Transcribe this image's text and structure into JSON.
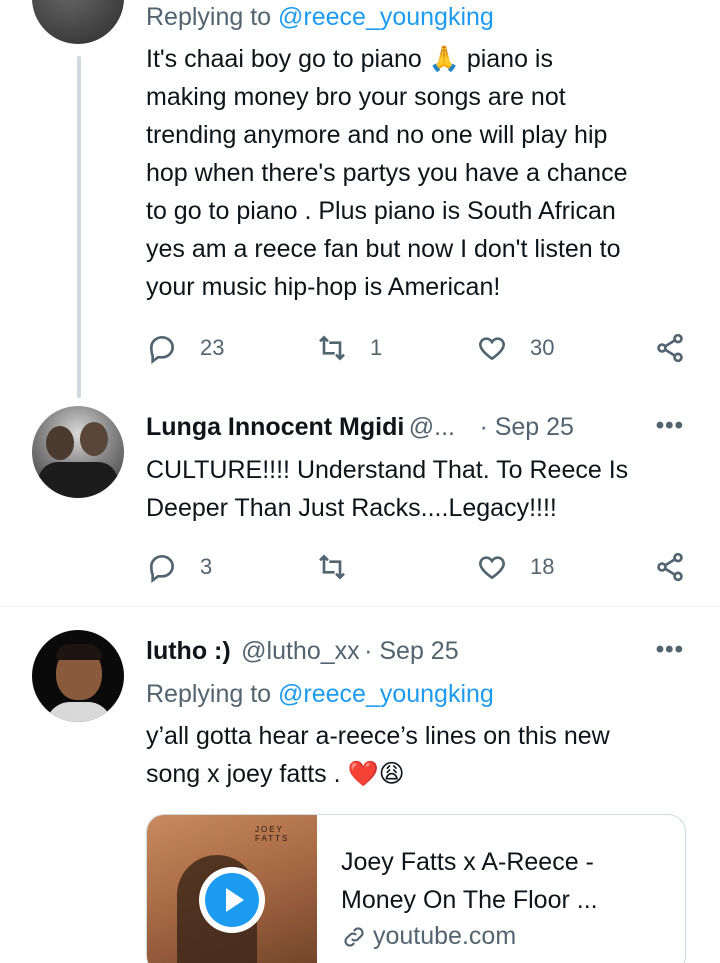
{
  "tweet1": {
    "replying_prefix": "Replying to",
    "replying_handle": "@reece_youngking",
    "lines": [
      "It's chaai boy go to piano 🙏 piano is",
      "making money bro your songs are not",
      "trending anymore and no one will play hip",
      "hop when there's partys you have a chance",
      "to go to piano . Plus piano is South African",
      "yes am a reece fan but now I don't listen to",
      "your music hip-hop is American!"
    ],
    "replies": "23",
    "retweets": "1",
    "likes": "30"
  },
  "tweet2": {
    "name": "Lunga Innocent Mgidi",
    "handle": "@...",
    "date": "· Sep 25",
    "lines": [
      "CULTURE!!!! Understand That. To Reece Is",
      "Deeper Than Just Racks....Legacy!!!!"
    ],
    "replies": "3",
    "retweets": "",
    "likes": "18"
  },
  "tweet3": {
    "name": "lutho :)",
    "handle": "@lutho_xx",
    "date": "· Sep 25",
    "replying_prefix": "Replying to",
    "replying_handle": "@reece_youngking",
    "lines": [
      "y’all gotta hear a-reece’s lines on this new",
      "song x joey fatts . ❤️😩"
    ],
    "card": {
      "title_line1": "Joey Fatts x A-Reece -",
      "title_line2": "Money On The Floor ...",
      "domain": "youtube.com",
      "thumb_text": "JOEY FATTS"
    }
  },
  "more_label": "•••",
  "colors": {
    "accent": "#1d9bf0",
    "text": "#0f1419",
    "secondary": "#536471",
    "heart": "#e0245e"
  },
  "icons": [
    "reply-icon",
    "retweet-icon",
    "like-icon",
    "share-icon",
    "more-icon",
    "link-icon",
    "play-icon"
  ]
}
